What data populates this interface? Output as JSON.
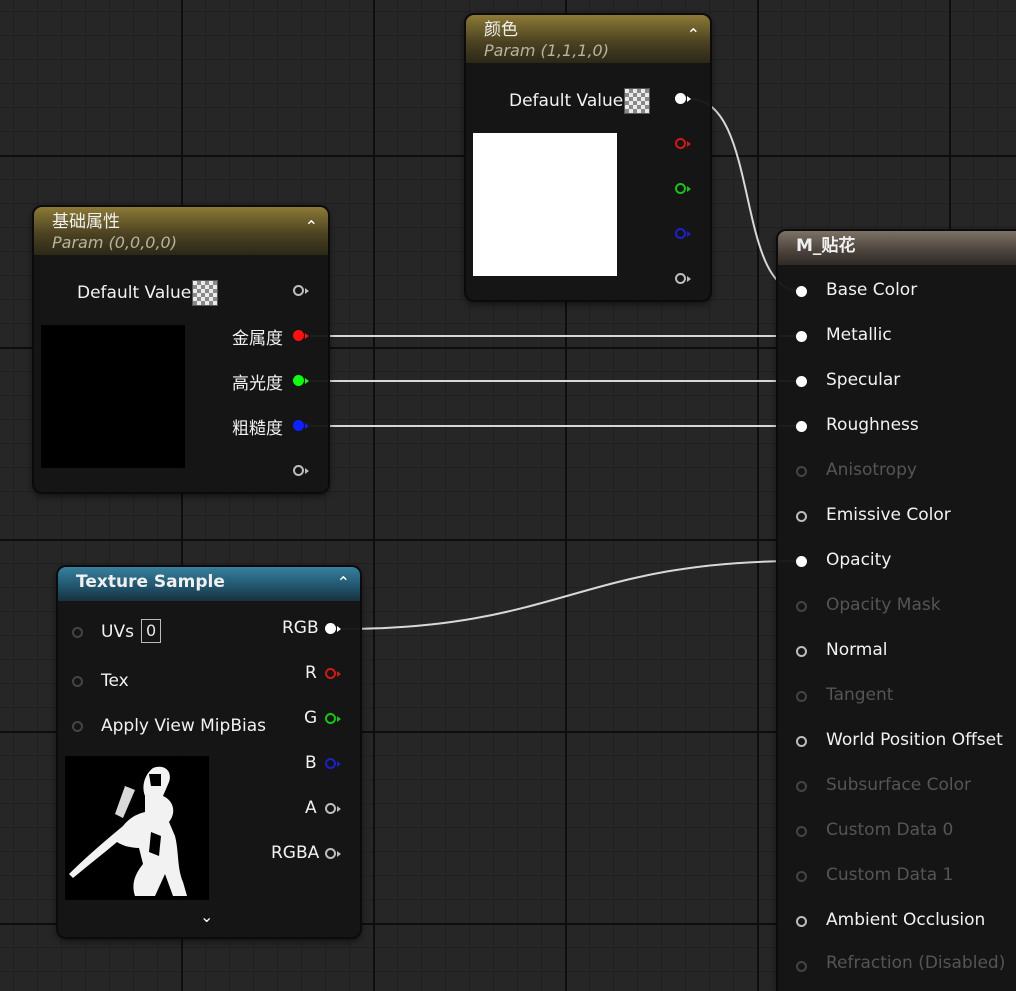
{
  "color_node": {
    "title": "颜色",
    "subtitle": "Param (1,1,1,0)",
    "default_value_label": "Default Value"
  },
  "base_node": {
    "title": "基础属性",
    "subtitle": "Param (0,0,0,0)",
    "default_value_label": "Default Value",
    "outputs": [
      "金属度",
      "高光度",
      "粗糙度"
    ]
  },
  "texture_node": {
    "title": "Texture Sample",
    "inputs": [
      "UVs",
      "Tex",
      "Apply View MipBias"
    ],
    "uvs_value": "0",
    "outputs": [
      "RGB",
      "R",
      "G",
      "B",
      "A",
      "RGBA"
    ]
  },
  "material_node": {
    "title": "M_贴花",
    "inputs": [
      "Base Color",
      "Metallic",
      "Specular",
      "Roughness",
      "Anisotropy",
      "Emissive Color",
      "Opacity",
      "Opacity Mask",
      "Normal",
      "Tangent",
      "World Position Offset",
      "Subsurface Color",
      "Custom Data 0",
      "Custom Data 1",
      "Ambient Occlusion",
      "Refraction (Disabled)"
    ]
  }
}
